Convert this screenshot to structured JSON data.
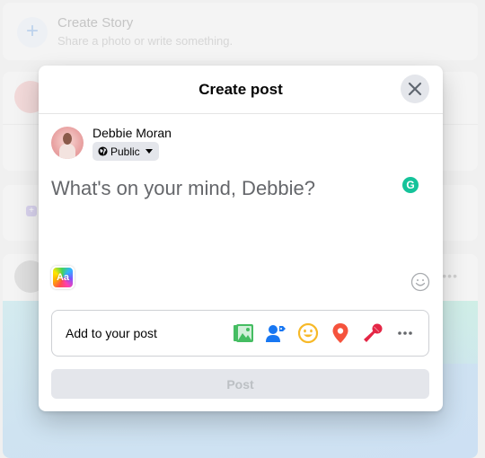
{
  "background": {
    "story": {
      "title": "Create Story",
      "subtitle": "Share a photo or write something.",
      "icon": "plus-icon"
    }
  },
  "modal": {
    "title": "Create post",
    "close_icon": "close-icon",
    "user": {
      "name": "Debbie Moran",
      "privacy": "Public",
      "privacy_icon": "globe-icon"
    },
    "composer": {
      "placeholder": "What's on your mind, Debbie?",
      "value": ""
    },
    "grammarly_icon": "G",
    "text_background_label": "Aa",
    "add_to_post": {
      "label": "Add to your post",
      "items": [
        {
          "name": "photo-video",
          "icon": "photo-icon",
          "color": "#45bd62"
        },
        {
          "name": "tag-people",
          "icon": "tag-people-icon",
          "color": "#1877f2"
        },
        {
          "name": "feeling-activity",
          "icon": "smiley-icon",
          "color": "#f7b928"
        },
        {
          "name": "check-in",
          "icon": "location-pin-icon",
          "color": "#f5533d"
        },
        {
          "name": "host-qa",
          "icon": "microphone-icon",
          "color": "#e42645"
        },
        {
          "name": "more",
          "icon": "more-icon",
          "color": "#65676b"
        }
      ]
    },
    "post_button": "Post"
  }
}
